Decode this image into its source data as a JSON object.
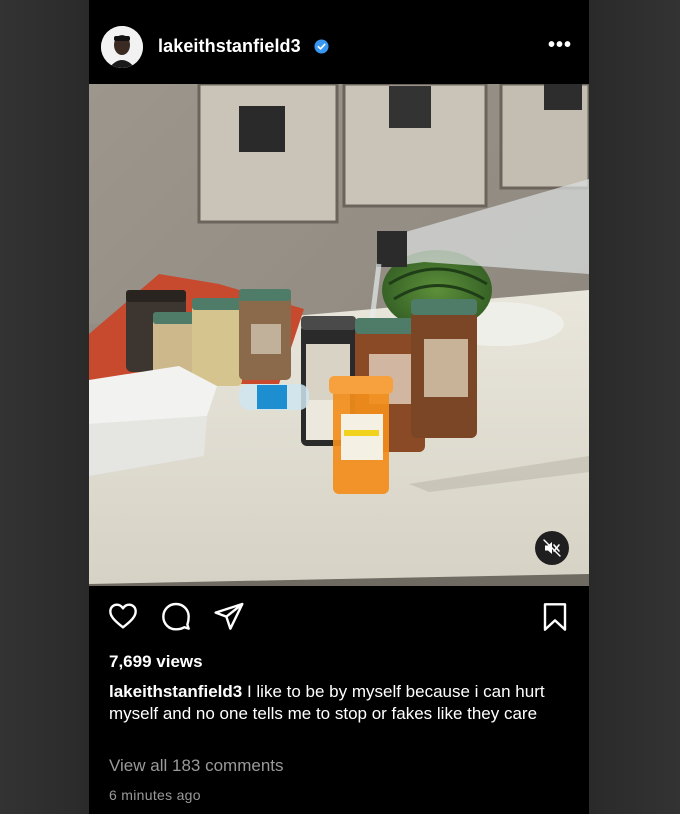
{
  "post": {
    "username": "lakeithstanfield3",
    "more_label": "•••",
    "views": "7,699 views",
    "caption_user": "lakeithstanfield3",
    "caption_text": "I like to be by myself because i can hurt myself and no one tells me to stop or fakes like they care",
    "view_comments": "View all 183 comments",
    "timestamp": "6 minutes ago"
  },
  "icons": {
    "verified": "verified-badge-icon",
    "like": "heart-icon",
    "comment": "comment-icon",
    "share": "send-icon",
    "save": "bookmark-icon",
    "mute": "muted-speaker-icon"
  },
  "colors": {
    "background": "#000000",
    "verified": "#3897f0",
    "secondary_text": "#9a9a9a"
  }
}
